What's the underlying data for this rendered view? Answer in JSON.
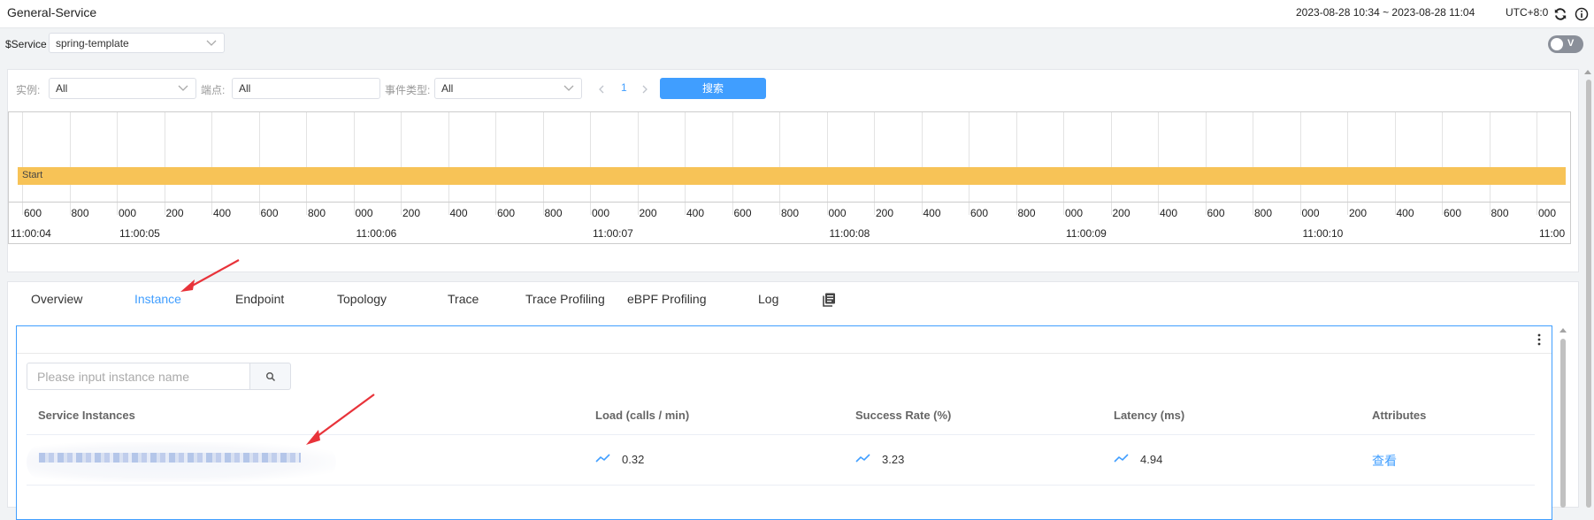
{
  "header": {
    "title": "General-Service",
    "time_range": "2023-08-28 10:34 ~ 2023-08-28 11:04",
    "timezone": "UTC+8:0",
    "refresh_icon": "refresh-icon",
    "info_icon": "info-icon"
  },
  "service_selector": {
    "label": "$Service",
    "value": "spring-template"
  },
  "mode_toggle": {
    "label": "V",
    "on": false
  },
  "filters": {
    "instance_label": "实例:",
    "instance_value": "All",
    "endpoint_label": "端点:",
    "endpoint_value": "All",
    "event_type_label": "事件类型:",
    "event_type_value": "All",
    "page": "1",
    "search_label": "搜索"
  },
  "timeline": {
    "bar_label": "Start",
    "ms_ticks": [
      "600",
      "800",
      "000",
      "200",
      "400",
      "600",
      "800",
      "000",
      "200",
      "400",
      "600",
      "800",
      "000",
      "200",
      "400",
      "600",
      "800",
      "000",
      "200",
      "400",
      "600",
      "800",
      "000",
      "200",
      "400",
      "600",
      "800",
      "000",
      "200",
      "400",
      "600",
      "800",
      "000"
    ],
    "second_labels": [
      "11:00:04",
      "11:00:05",
      "11:00:06",
      "11:00:07",
      "11:00:08",
      "11:00:09",
      "11:00:10",
      "11:00"
    ]
  },
  "tabs": [
    {
      "label": "Overview",
      "active": false
    },
    {
      "label": "Instance",
      "active": true
    },
    {
      "label": "Endpoint",
      "active": false
    },
    {
      "label": "Topology",
      "active": false
    },
    {
      "label": "Trace",
      "active": false
    },
    {
      "label": "Trace Profiling",
      "active": false
    },
    {
      "label": "eBPF Profiling",
      "active": false
    },
    {
      "label": "Log",
      "active": false
    }
  ],
  "instance_widget": {
    "search_placeholder": "Please input instance name",
    "columns": [
      "Service Instances",
      "Load (calls / min)",
      "Success Rate (%)",
      "Latency (ms)",
      "Attributes"
    ],
    "rows": [
      {
        "load": "0.32",
        "success_rate": "3.23",
        "latency": "4.94",
        "attributes_link": "查看"
      }
    ]
  },
  "colors": {
    "accent": "#409eff",
    "timeline_bar": "#f7c357",
    "annotation_arrow": "#e8333a"
  }
}
